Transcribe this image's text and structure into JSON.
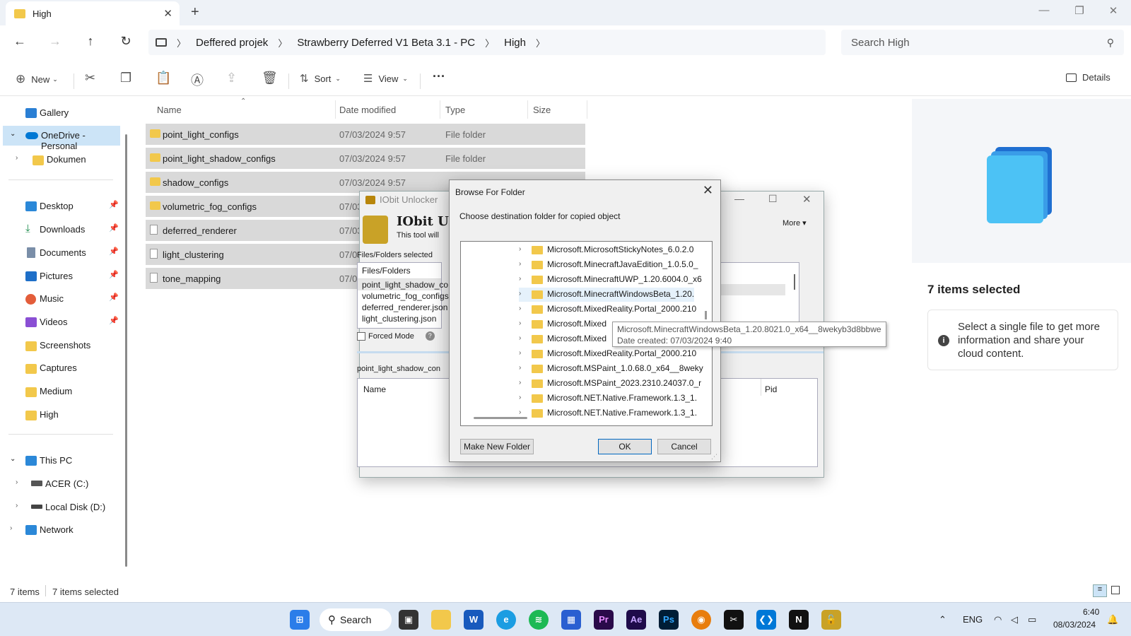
{
  "window": {
    "tab_title": "High",
    "breadcrumb": [
      "Deffered projek",
      "Strawberry Deferred V1 Beta 3.1 - PC",
      "High"
    ],
    "search_placeholder": "Search High"
  },
  "toolbar": {
    "new_label": "New",
    "sort_label": "Sort",
    "view_label": "View",
    "details_label": "Details"
  },
  "sidebar": {
    "gallery": "Gallery",
    "onedrive": "OneDrive - Personal",
    "dokumen": "Dokumen",
    "quick": [
      "Desktop",
      "Downloads",
      "Documents",
      "Pictures",
      "Music",
      "Videos",
      "Screenshots",
      "Captures",
      "Medium",
      "High"
    ],
    "this_pc": "This PC",
    "drive_c": "ACER (C:)",
    "drive_d": "Local Disk (D:)",
    "network": "Network"
  },
  "files": {
    "columns": [
      "Name",
      "Date modified",
      "Type",
      "Size"
    ],
    "rows": [
      {
        "name": "point_light_configs",
        "date": "07/03/2024 9:57",
        "type": "File folder"
      },
      {
        "name": "point_light_shadow_configs",
        "date": "07/03/2024 9:57",
        "type": "File folder"
      },
      {
        "name": "shadow_configs",
        "date": "07/03/2024 9:57",
        "type": "File folder"
      },
      {
        "name": "volumetric_fog_configs",
        "date": "07/03",
        "type": ""
      },
      {
        "name": "deferred_renderer",
        "date": "07/03",
        "type": ""
      },
      {
        "name": "light_clustering",
        "date": "07/03",
        "type": ""
      },
      {
        "name": "tone_mapping",
        "date": "07/03",
        "type": ""
      }
    ]
  },
  "details": {
    "selected": "7 items selected",
    "info": "Select a single file to get more information and share your cloud content."
  },
  "status": {
    "items": "7 items",
    "selected": "7 items selected"
  },
  "iobit": {
    "title": "IObit Unlocker",
    "heading": "IObit Un",
    "sub": "This tool will",
    "more": "More ▾",
    "files_selected_label": "Files/Folders selected",
    "list_header": "Files/Folders",
    "list_items": [
      "point_light_shadow_co",
      "volumetric_fog_configs",
      "deferred_renderer.json",
      "light_clustering.json"
    ],
    "status_right": [
      "ed",
      "ed",
      "ed"
    ],
    "forced_mode": "Forced Mode",
    "path": "point_light_shadow_con",
    "name_col": "Name",
    "pid_col": "Pid"
  },
  "browse": {
    "title": "Browse For Folder",
    "prompt": "Choose destination folder for copied object",
    "items": [
      "Microsoft.MicrosoftStickyNotes_6.0.2.0",
      "Microsoft.MinecraftJavaEdition_1.0.5.0_",
      "Microsoft.MinecraftUWP_1.20.6004.0_x6",
      "Microsoft.MinecraftWindowsBeta_1.20.",
      "Microsoft.MixedReality.Portal_2000.210",
      "Microsoft.Mixed",
      "Microsoft.Mixed",
      "Microsoft.MixedReality.Portal_2000.210",
      "Microsoft.MSPaint_1.0.68.0_x64__8weky",
      "Microsoft.MSPaint_2023.2310.24037.0_r",
      "Microsoft.NET.Native.Framework.1.3_1.",
      "Microsoft.NET.Native.Framework.1.3_1."
    ],
    "make_new_folder": "Make New Folder",
    "ok": "OK",
    "cancel": "Cancel",
    "tooltip_line1": "Microsoft.MinecraftWindowsBeta_1.20.8021.0_x64__8wekyb3d8bbwe",
    "tooltip_line2": "Date created: 07/03/2024 9:40"
  },
  "taskbar": {
    "search": "Search",
    "lang": "ENG",
    "time": "6:40",
    "date": "08/03/2024"
  },
  "colors": {
    "accent": "#0067c0",
    "selection": "#d9d9d9",
    "folder": "#f2c84b",
    "onedrive": "#0078d4"
  }
}
